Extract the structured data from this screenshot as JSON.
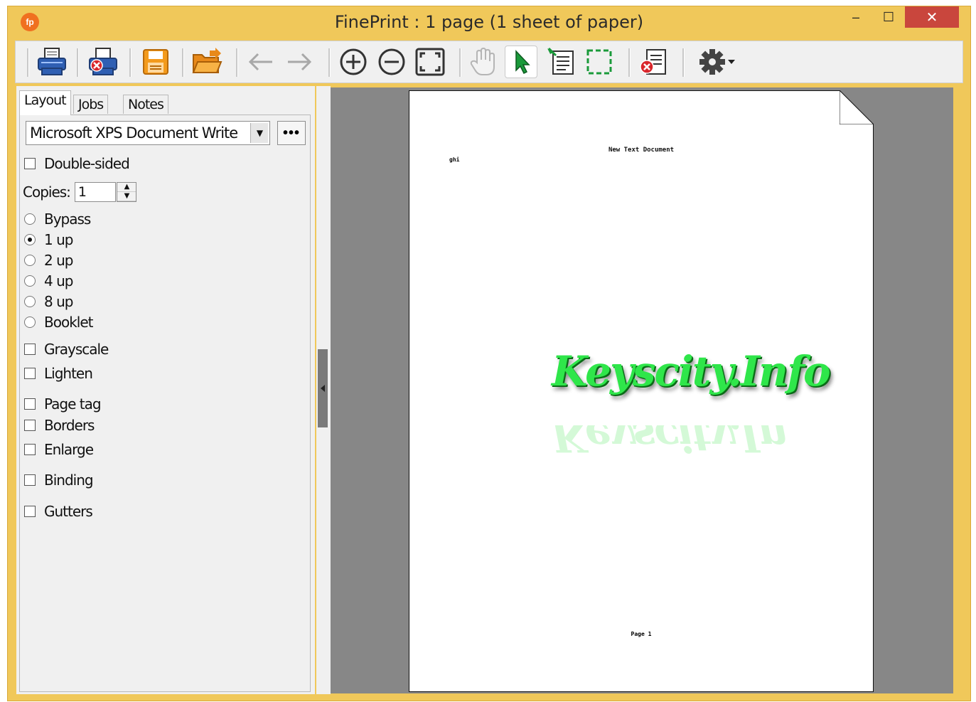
{
  "window": {
    "title": "FinePrint : 1 page (1 sheet of paper)",
    "app_icon_text": "fp",
    "controls": {
      "minimize": "–",
      "maximize": "☐",
      "close": "✕"
    }
  },
  "toolbar": {
    "buttons": [
      {
        "name": "print-button",
        "icon": "printer-icon"
      },
      {
        "name": "print-delete-button",
        "icon": "printer-delete-icon"
      },
      {
        "name": "save-button",
        "icon": "floppy-icon"
      },
      {
        "name": "open-button",
        "icon": "folder-icon"
      },
      {
        "name": "back-button",
        "icon": "arrow-left-icon"
      },
      {
        "name": "forward-button",
        "icon": "arrow-right-icon"
      },
      {
        "name": "zoom-in-button",
        "icon": "zoom-in-icon"
      },
      {
        "name": "zoom-out-button",
        "icon": "zoom-out-icon"
      },
      {
        "name": "fit-page-button",
        "icon": "fit-icon"
      },
      {
        "name": "pan-button",
        "icon": "hand-icon"
      },
      {
        "name": "select-button",
        "icon": "cursor-icon",
        "active": true
      },
      {
        "name": "text-select-button",
        "icon": "text-select-icon"
      },
      {
        "name": "marquee-button",
        "icon": "marquee-icon"
      },
      {
        "name": "delete-page-button",
        "icon": "delete-page-icon"
      },
      {
        "name": "settings-button",
        "icon": "gear-icon"
      }
    ]
  },
  "tabs": [
    "Layout",
    "Jobs",
    "Notes"
  ],
  "layout": {
    "printer": "Microsoft XPS Document Write",
    "more_label": "•••",
    "double_sided": "Double-sided",
    "copies_label": "Copies:",
    "copies_value": "1",
    "modes": [
      "Bypass",
      "1 up",
      "2 up",
      "4 up",
      "8 up",
      "Booklet"
    ],
    "selected_mode": "1 up",
    "options": [
      "Grayscale",
      "Lighten",
      "Page tag",
      "Borders",
      "Enlarge",
      "Binding",
      "Gutters"
    ]
  },
  "preview": {
    "heading": "New Text Document",
    "body_line": "ghi",
    "footer": "Page 1",
    "watermark": "Keyscity.Info"
  },
  "colors": {
    "window_frame": "#f0c85a",
    "close_button": "#c9463d",
    "preview_background": "#878787",
    "watermark_green": "#2fe64a",
    "folder_orange": "#f39a1c"
  }
}
